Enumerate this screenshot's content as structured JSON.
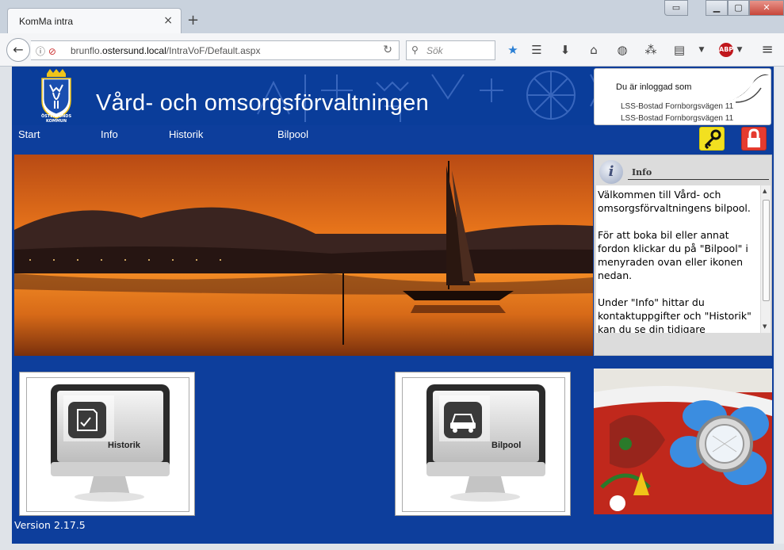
{
  "browser": {
    "tab_title": "KomMa intra",
    "tab_close": "×",
    "new_tab": "+",
    "url_prefix": "brunflo.",
    "url_host": "ostersund.local",
    "url_path": "/IntraVoF/Default.aspx",
    "search_placeholder": "Sök",
    "abp_label": "ABP"
  },
  "header": {
    "title": "Vård- och omsorgsförvaltningen",
    "crest_text": "ÖSTERSUNDS KOMMUN"
  },
  "login": {
    "title": "Du är inloggad som",
    "line1": "LSS-Bostad Fornborgsvägen 11",
    "line2": "LSS-Bostad Fornborgsvägen 11"
  },
  "nav": {
    "start": "Start",
    "info": "Info",
    "historik": "Historik",
    "bilpool": "Bilpool"
  },
  "info_panel": {
    "title": "Info",
    "paragraphs": [
      "Välkommen till Vård- och omsorgsförvaltningens bilpool.",
      "För att boka bil eller annat fordon klickar du på \"Bilpool\" i menyraden ovan eller ikonen nedan.",
      "Under \"Info\" hittar du kontaktuppgifter och \"Historik\" kan du se din tidigare"
    ]
  },
  "tiles": {
    "historik_label": "Historik",
    "bilpool_label": "Bilpool"
  },
  "footer": {
    "version": "Version 2.17.5"
  },
  "colors": {
    "page_blue": "#0d3e9c",
    "key_yellow": "#f2e020",
    "lock_red": "#e53b2f"
  }
}
